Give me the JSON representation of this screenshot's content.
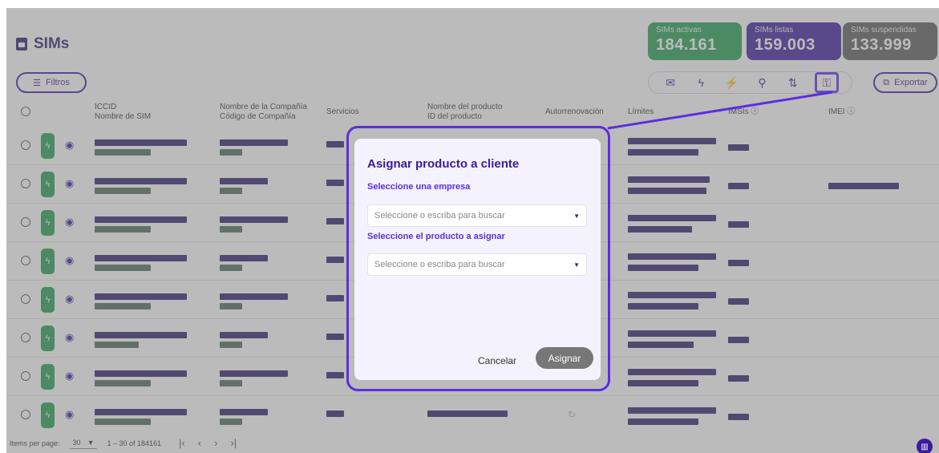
{
  "header": {
    "title": "SIMs"
  },
  "stats": [
    {
      "label": "SIMs activas",
      "value": "184.161",
      "color": "#1f9c4f"
    },
    {
      "label": "SIMs listas",
      "value": "159.003",
      "color": "#3b1a9c"
    },
    {
      "label": "SIMs suspendidas",
      "value": "133.999",
      "color": "#5a5a5a"
    }
  ],
  "toolbar": {
    "filters_label": "Filtros",
    "export_label": "Exportar"
  },
  "table": {
    "columns": [
      {
        "line1": "ICCID",
        "line2": "Nombre de SIM"
      },
      {
        "line1": "Nombre de la Compañía",
        "line2": "Código de Compañía"
      },
      {
        "line1": "Servicios",
        "line2": ""
      },
      {
        "line1": "Nombre del producto",
        "line2": "ID del producto"
      },
      {
        "line1": "Autorrenovación",
        "line2": ""
      },
      {
        "line1": "Límites",
        "line2": ""
      },
      {
        "line1": "IMSIs ⓘ",
        "line2": ""
      },
      {
        "line1": "IMEI ⓘ",
        "line2": ""
      }
    ]
  },
  "pagination": {
    "items_per_page_label": "Items per page:",
    "page_size": "30",
    "range": "1 – 30 of 184161"
  },
  "modal": {
    "title": "Asignar producto a cliente",
    "company_label": "Seleccione una empresa",
    "company_placeholder": "Seleccione o escriba para buscar",
    "product_label": "Seleccione el producto a asignar",
    "product_placeholder": "Seleccione o escriba para buscar",
    "cancel_label": "Cancelar",
    "assign_label": "Asignar"
  }
}
